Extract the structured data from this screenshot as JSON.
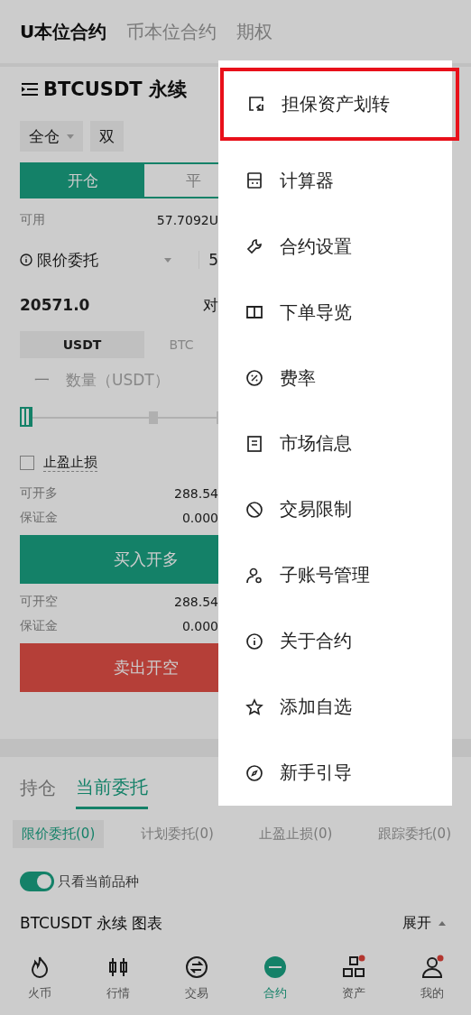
{
  "top_tabs": [
    {
      "label": "U本位合约",
      "selected": true
    },
    {
      "label": "币本位合约",
      "selected": false
    },
    {
      "label": "期权",
      "selected": false
    }
  ],
  "symbol": {
    "title": "BTCUSDT 永续"
  },
  "margin_mode": {
    "mode": "全仓",
    "side": "双"
  },
  "action_tabs": [
    {
      "label": "开仓",
      "selected": true
    },
    {
      "label": "平",
      "selected": false
    }
  ],
  "available": {
    "label": "可用",
    "value": "57.7092U"
  },
  "order_type": {
    "label": "限价委托",
    "value": "5"
  },
  "price": {
    "value": "20571.0",
    "side": "对"
  },
  "unit_tabs": [
    {
      "label": "USDT",
      "selected": true
    },
    {
      "label": "BTC",
      "selected": false
    }
  ],
  "quantity": {
    "minus": "一",
    "placeholder": "数量（USDT）"
  },
  "slider": {
    "level": 0
  },
  "tpsl": {
    "label": "止盈止损",
    "checked": false
  },
  "long": {
    "rows": [
      {
        "label": "可开多",
        "value": "288.54"
      },
      {
        "label": "保证金",
        "value": "0.000"
      }
    ],
    "button": "买入开多"
  },
  "short": {
    "rows": [
      {
        "label": "可开空",
        "value": "288.54"
      },
      {
        "label": "保证金",
        "value": "0.000"
      }
    ],
    "button": "卖出开空"
  },
  "order_tabs": [
    {
      "label": "持仓",
      "selected": false
    },
    {
      "label": "当前委托",
      "selected": true
    }
  ],
  "order_filters": [
    {
      "label": "限价委托(0)",
      "selected": true
    },
    {
      "label": "计划委托(0)",
      "selected": false
    },
    {
      "label": "止盈止损(0)",
      "selected": false
    },
    {
      "label": "跟踪委托(0)",
      "selected": false
    }
  ],
  "current_only": {
    "label": "只看当前品种",
    "on": true
  },
  "chart_row": {
    "title": "BTCUSDT 永续 图表",
    "toggle": "展开"
  },
  "menu": [
    {
      "label": "担保资产划转",
      "highlighted": true
    },
    {
      "label": "计算器",
      "highlighted": false
    },
    {
      "label": "合约设置",
      "highlighted": false
    },
    {
      "label": "下单导览",
      "highlighted": false
    },
    {
      "label": "费率",
      "highlighted": false
    },
    {
      "label": "市场信息",
      "highlighted": false
    },
    {
      "label": "交易限制",
      "highlighted": false
    },
    {
      "label": "子账号管理",
      "highlighted": false
    },
    {
      "label": "关于合约",
      "highlighted": false
    },
    {
      "label": "添加自选",
      "highlighted": false
    },
    {
      "label": "新手引导",
      "highlighted": false
    }
  ],
  "bottom_nav": [
    {
      "label": "火币",
      "selected": false,
      "badge": false
    },
    {
      "label": "行情",
      "selected": false,
      "badge": false
    },
    {
      "label": "交易",
      "selected": false,
      "badge": false
    },
    {
      "label": "合约",
      "selected": true,
      "badge": false
    },
    {
      "label": "资产",
      "selected": false,
      "badge": true
    },
    {
      "label": "我的",
      "selected": false,
      "badge": true
    }
  ]
}
